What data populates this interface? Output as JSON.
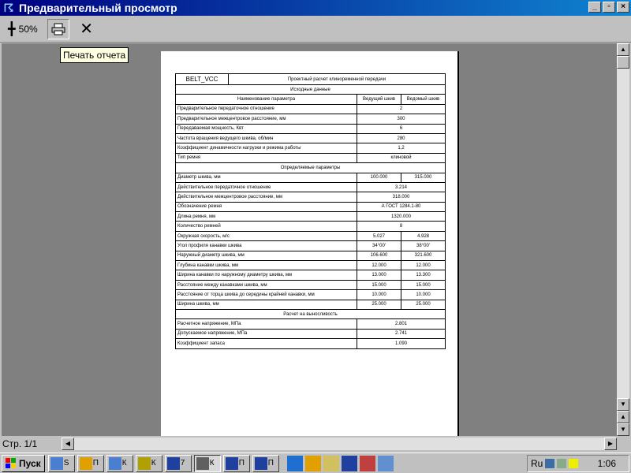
{
  "window": {
    "title": "Предварительный просмотр",
    "app_icon": "preview-app-icon"
  },
  "toolbar": {
    "zoom_label": "50%",
    "print_tooltip": "Печать отчета"
  },
  "status": {
    "page": "Стр. 1/1"
  },
  "document": {
    "code": "BELT_VCC",
    "title": "Проектный расчет клиноременной передачи",
    "sections": [
      {
        "title": "Исходные данные",
        "headers": [
          "Наименование параметра",
          "Ведущий шкив",
          "Ведомый шкив"
        ],
        "rows": [
          {
            "label": "Предварительное передаточное отношение",
            "value": "2"
          },
          {
            "label": "Предварительное межцентровое расстояние, мм",
            "value": "300"
          },
          {
            "label": "Передаваемая мощность, Квт",
            "value": "6"
          },
          {
            "label": "Частота вращения ведущего шкива, об/мин",
            "value": "280"
          },
          {
            "label": "Коэффициент динамичности нагрузки и режима работы",
            "value": "1,2"
          },
          {
            "label": "Тип ремня",
            "value": "клиновой"
          }
        ]
      },
      {
        "title": "Определяемые параметры",
        "rows": [
          {
            "label": "Диаметр шкива, мм",
            "v1": "100.000",
            "v2": "315.000"
          },
          {
            "label": "Действительное передаточное отношение",
            "value": "3.214"
          },
          {
            "label": "Действительное межцентровое расстояние, мм",
            "value": "318.000"
          },
          {
            "label": "Обозначение ремня",
            "value": "А ГОСТ 1284.1-80"
          },
          {
            "label": "Длина ремня, мм",
            "value": "1320.000"
          },
          {
            "label": "Количество ремней",
            "value": "8"
          },
          {
            "label": "Окружная скорость, м/с",
            "v1": "5.027",
            "v2": "4.928"
          },
          {
            "label": "Угол профиля канавки шкива",
            "v1": "34°00'",
            "v2": "38°00'"
          },
          {
            "label": "Наружный диаметр шкива, мм",
            "v1": "106.600",
            "v2": "321.600"
          },
          {
            "label": "Глубина канавки шкива, мм",
            "v1": "12.000",
            "v2": "12.000"
          },
          {
            "label": "Ширина канавки по наружному диаметру шкива, мм",
            "v1": "13.000",
            "v2": "13.300"
          },
          {
            "label": "Расстояние между канавками шкива, мм",
            "v1": "15.000",
            "v2": "15.000"
          },
          {
            "label": "Расстояние от торца шкива до середины крайней канавки, мм",
            "v1": "10.000",
            "v2": "10.000"
          },
          {
            "label": "Ширина шкива, мм",
            "v1": "25.000",
            "v2": "25.000"
          }
        ]
      },
      {
        "title": "Расчет на выносливость",
        "rows": [
          {
            "label": "Расчетное напряжение, МПа",
            "value": "2.801"
          },
          {
            "label": "Допускаемое напряжение, МПа",
            "value": "2.741"
          },
          {
            "label": "Коэффициент запаса",
            "value": "1.090"
          }
        ]
      }
    ]
  },
  "taskbar": {
    "start_label": "Пуск",
    "tasks": [
      {
        "label": "S",
        "icon": "explorer-icon"
      },
      {
        "label": "П",
        "icon": "player-icon"
      },
      {
        "label": "К",
        "icon": "explorer-icon"
      },
      {
        "label": "К",
        "icon": "tool-icon"
      },
      {
        "label": "7",
        "icon": "word-icon"
      },
      {
        "label": "К",
        "icon": "gear-icon",
        "active": true
      },
      {
        "label": "П",
        "icon": "word-icon"
      },
      {
        "label": "П",
        "icon": "word-icon"
      }
    ],
    "quick_launch": [
      "ie-icon",
      "player-icon",
      "notepad-icon",
      "word-icon",
      "paint-icon",
      "search-icon"
    ],
    "tray": {
      "lang": "Ru",
      "clock": "1:06"
    }
  }
}
